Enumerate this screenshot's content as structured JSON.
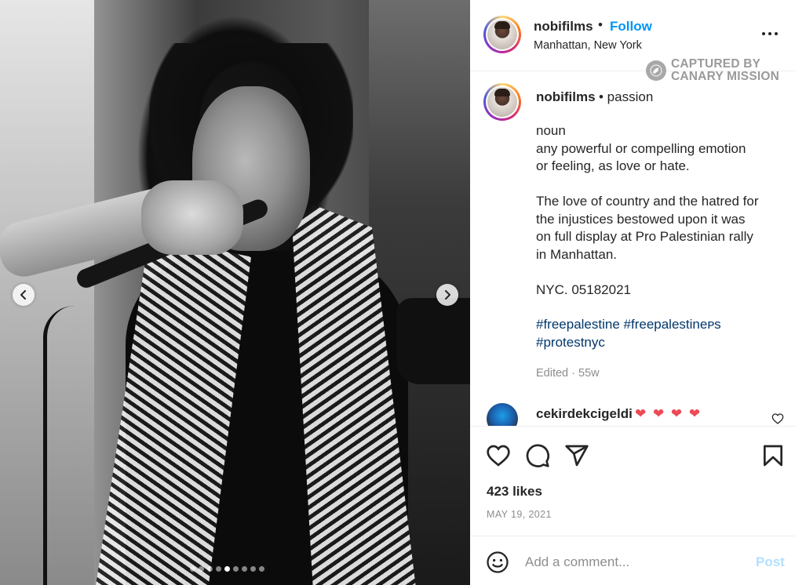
{
  "post": {
    "username": "nobifilms",
    "separator": "•",
    "follow_label": "Follow",
    "location": "Manhattan, New York",
    "watermark": {
      "line1": "CAPTURED BY",
      "line2": "CANARY MISSION"
    },
    "carousel": {
      "slide_count": 9,
      "active_index": 4
    }
  },
  "caption": {
    "username": "nobifilms",
    "inline_text": "• passion",
    "lines_1": [
      "noun",
      "any powerful or compelling emotion",
      "or feeling, as love or hate."
    ],
    "lines_2": [
      "The love of country and the hatred for",
      "the injustices bestowed upon it was",
      "on full display at Pro Palestinian rally",
      "in Manhattan."
    ],
    "lines_3": [
      "NYC. 05182021"
    ],
    "hashtags": [
      "#freepalestine #freepalestineᴘs",
      "#protestnyc"
    ],
    "meta": "Edited · 55w"
  },
  "reply": {
    "username": "cekirdekcigeldi",
    "text": "❤ ❤ ❤ ❤"
  },
  "actions": {
    "likes": "423 likes",
    "date": "MAY 19, 2021"
  },
  "composer": {
    "placeholder": "Add a comment...",
    "post_label": "Post"
  },
  "colors": {
    "link_blue": "#0095f6",
    "hashtag_blue": "#00376b",
    "heart_red": "#ed4956",
    "post_disabled": "#b2dffc",
    "muted": "#8e8e8e"
  },
  "icons": {
    "nav_prev": "chevron-left-icon",
    "nav_next": "chevron-right-icon",
    "more": "more-horizontal-icon",
    "like": "heart-icon",
    "comment": "comment-icon",
    "share": "paper-plane-icon",
    "save": "bookmark-icon",
    "emoji": "smiley-icon",
    "watermark_seal": "canary-seal-icon"
  }
}
